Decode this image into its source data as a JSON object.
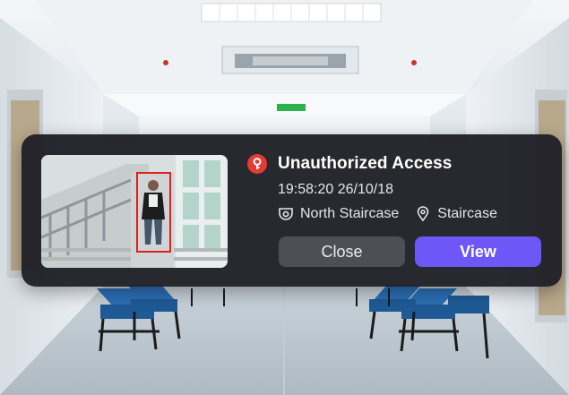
{
  "notification": {
    "title": "Unauthorized Access",
    "timestamp": "19:58:20 26/10/18",
    "camera_name": "North Staircase",
    "location_name": "Staircase",
    "close_label": "Close",
    "view_label": "View",
    "icons": {
      "alert": "key-alert-icon",
      "camera": "camera-icon",
      "location": "location-pin-icon"
    }
  },
  "colors": {
    "card_background": "#212128",
    "alert_red": "#e63b33",
    "view_button": "#6e56f7",
    "close_button": "#4e4e55",
    "detection_box": "#e0201c"
  }
}
